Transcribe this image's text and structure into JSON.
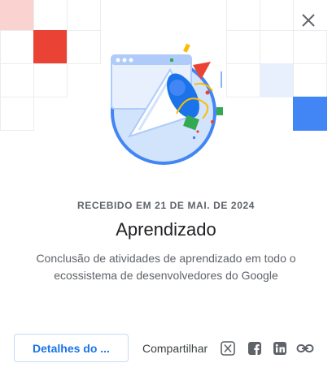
{
  "dialog": {
    "received_label": "RECEBIDO EM 21 DE MAI. DE 2024",
    "title": "Aprendizado",
    "description": "Conclusão de atividades de aprendizado em todo o ecossistema de desenvolvedores do Google"
  },
  "footer": {
    "details_button": "Detalhes do ...",
    "share_label": "Compartilhar",
    "share_icons": [
      "x-icon",
      "facebook-icon",
      "linkedin-icon",
      "link-icon"
    ]
  },
  "icons": {
    "close": "close-icon",
    "badge": "megaphone-confetti-icon"
  },
  "colors": {
    "accent": "#1a73e8",
    "grid_red": "#ea4335",
    "grid_pink": "#fad2cf",
    "grid_blue": "#4285f4",
    "grid_light_blue": "#e8f0fe"
  }
}
